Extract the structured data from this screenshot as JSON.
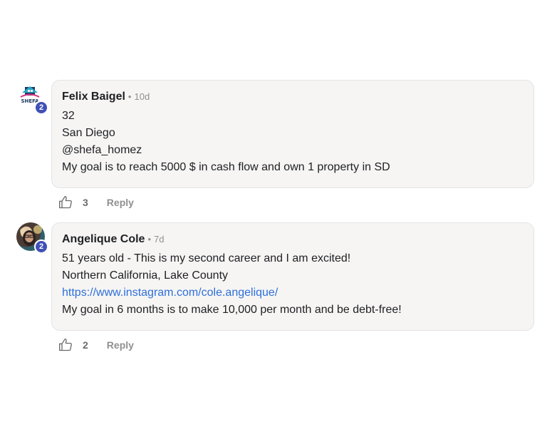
{
  "comments": [
    {
      "author": "Felix Baigel",
      "dot": "•",
      "time": "10d",
      "level": "2",
      "avatar_type": "logo-icon",
      "avatar_logo_text": "SHEFA",
      "lines": [
        "32",
        "San Diego",
        "@shefa_homez",
        "My goal is to reach 5000 $ in cash flow and own 1 property in SD"
      ],
      "likes": "3",
      "reply_label": "Reply"
    },
    {
      "author": "Angelique Cole",
      "dot": "•",
      "time": "7d",
      "level": "2",
      "avatar_type": "photo",
      "lines": [
        "51 years old - This is my second career and I am excited!",
        "Northern California, Lake County",
        "https://www.instagram.com/cole.angelique/",
        "My goal in 6 months is to make 10,000 per month and be debt-free!"
      ],
      "likes": "2",
      "reply_label": "Reply"
    }
  ],
  "colors": {
    "bubble_bg": "#f6f5f4",
    "link": "#2e6fd9",
    "badge": "#3f51b5"
  }
}
